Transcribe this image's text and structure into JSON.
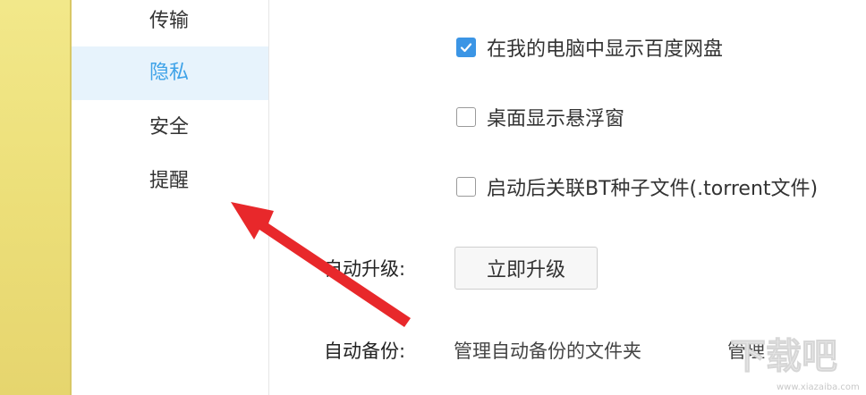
{
  "sidebar": {
    "items": [
      {
        "label": "传输",
        "active": false
      },
      {
        "label": "隐私",
        "active": true
      },
      {
        "label": "安全",
        "active": false
      },
      {
        "label": "提醒",
        "active": false
      }
    ]
  },
  "privacy": {
    "options": [
      {
        "label": "在我的电脑中显示百度网盘",
        "checked": true
      },
      {
        "label": "桌面显示悬浮窗",
        "checked": false
      },
      {
        "label": "启动后关联BT种子文件(.torrent文件)",
        "checked": false
      }
    ]
  },
  "upgrade": {
    "label": "自动升级:",
    "button_label": "立即升级"
  },
  "backup": {
    "label": "自动备份:",
    "text": "管理自动备份的文件夹",
    "manage_label": "管理"
  },
  "colors": {
    "accent": "#3ea2e8",
    "active_bg": "#e7f3fc",
    "arrow": "#e8282b",
    "left_strip": "#ecdf79"
  },
  "watermark": {
    "text": "下载吧",
    "url": "www.xiazaiba.com"
  }
}
